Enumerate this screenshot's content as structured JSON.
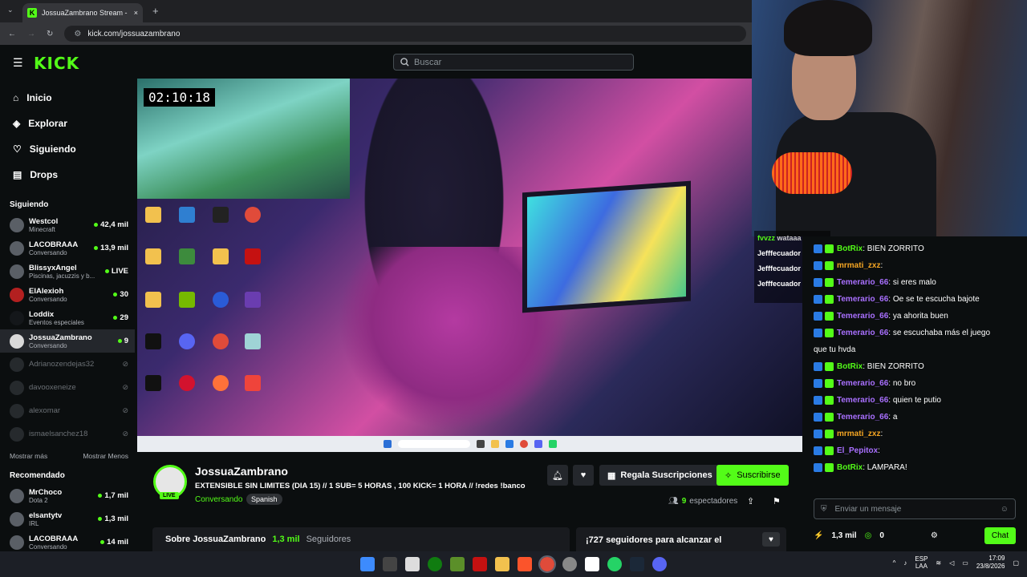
{
  "browser": {
    "tab_title": "JossuaZambrano Stream - Wat",
    "tab_close": "×",
    "new_tab": "+",
    "url": "kick.com/jossuazambrano"
  },
  "kick": {
    "logo": "KICK",
    "search_placeholder": "Buscar"
  },
  "nav": [
    {
      "label": "Inicio",
      "icon": "home-icon"
    },
    {
      "label": "Explorar",
      "icon": "compass-icon"
    },
    {
      "label": "Siguiendo",
      "icon": "heart-icon"
    },
    {
      "label": "Drops",
      "icon": "drops-icon"
    }
  ],
  "following": {
    "title": "Siguiendo",
    "channels": [
      {
        "name": "Westcol",
        "category": "Minecraft",
        "count": "42,4 mil"
      },
      {
        "name": "LACOBRAAA",
        "category": "Conversando",
        "count": "13,9 mil"
      },
      {
        "name": "BlissyxAngel",
        "category": "Piscinas, jacuzzis y b...",
        "count": "LIVE"
      },
      {
        "name": "ElAlexioh",
        "category": "Conversando",
        "count": "30"
      },
      {
        "name": "Loddix",
        "category": "Eventos especiales",
        "count": "29"
      },
      {
        "name": "JossuaZambrano",
        "category": "Conversando",
        "count": "9"
      }
    ],
    "offline": [
      "Adrianozendejas32",
      "davooxeneize",
      "alexomar",
      "ismaelsanchez18"
    ],
    "show_more": "Mostrar más",
    "show_less": "Mostrar Menos"
  },
  "recommended": {
    "title": "Recomendado",
    "channels": [
      {
        "name": "MrChoco",
        "category": "Dota 2",
        "count": "1,7 mil"
      },
      {
        "name": "elsantytv",
        "category": "IRL",
        "count": "1,3 mil"
      },
      {
        "name": "LACOBRAAA",
        "category": "Conversando",
        "count": "14 mil"
      }
    ]
  },
  "video": {
    "timer": "02:10:18"
  },
  "stream": {
    "channel": "JossuaZambrano",
    "live": "LIVE",
    "title": "EXTENSIBLE SIN LIMITES (DIA 15) // 1 SUB= 5 HORAS , 100 KICK= 1 HORA // !redes !banco",
    "category": "Conversando",
    "language": "Spanish",
    "gift_label": "Regala Suscripciones",
    "subscribe_label": "Suscribirse",
    "viewers_count": "9",
    "viewers_label": "espectadores",
    "about_label": "Sobre JossuaZambrano",
    "followers_count": "1,3 mil",
    "followers_label": "Seguidores",
    "goal_text": "¡727 seguidores para alcanzar el"
  },
  "overlap_chat": [
    {
      "user": "fvvzz",
      "text": "wataaa"
    },
    {
      "user": "Jefffecuador",
      "text": ""
    },
    {
      "user": "Jefffecuador",
      "text": ""
    },
    {
      "user": "Jefffecuador",
      "text": ""
    }
  ],
  "chat": {
    "messages": [
      {
        "user": "BotRix",
        "color": "#53fc18",
        "text": "BIEN ZORRITO"
      },
      {
        "user": "mrmati_zxz",
        "color": "#f5a623",
        "text": ""
      },
      {
        "user": "Temerario_66",
        "color": "#a970ff",
        "text": "si eres malo"
      },
      {
        "user": "Temerario_66",
        "color": "#a970ff",
        "text": "Oe se te escucha bajote"
      },
      {
        "user": "Temerario_66",
        "color": "#a970ff",
        "text": "ya ahorita buen"
      },
      {
        "user": "Temerario_66",
        "color": "#a970ff",
        "text": "se escuchaba más el juego"
      },
      {
        "user": "",
        "color": "#ffffff",
        "text": "que tu hvda"
      },
      {
        "user": "BotRix",
        "color": "#53fc18",
        "text": "BIEN ZORRITO"
      },
      {
        "user": "Temerario_66",
        "color": "#a970ff",
        "text": "no bro"
      },
      {
        "user": "Temerario_66",
        "color": "#a970ff",
        "text": "quien te putio"
      },
      {
        "user": "Temerario_66",
        "color": "#a970ff",
        "text": "a"
      },
      {
        "user": "mrmati_zxz",
        "color": "#f5a623",
        "text": ""
      },
      {
        "user": "El_Pepitox",
        "color": "#a970ff",
        "text": ""
      },
      {
        "user": "BotRix",
        "color": "#53fc18",
        "text": "LAMPARA!"
      }
    ],
    "input_placeholder": "Enviar un mensaje",
    "points": "1,3 mil",
    "kicks": "0",
    "chat_button": "Chat"
  },
  "systray": {
    "lang": "ESP",
    "layout": "LAA",
    "time": "17:09",
    "date": "23/8/2026"
  },
  "colors": {
    "kick_green": "#53fc18",
    "bg": "#0b0e0f",
    "panel": "#191b1f"
  }
}
